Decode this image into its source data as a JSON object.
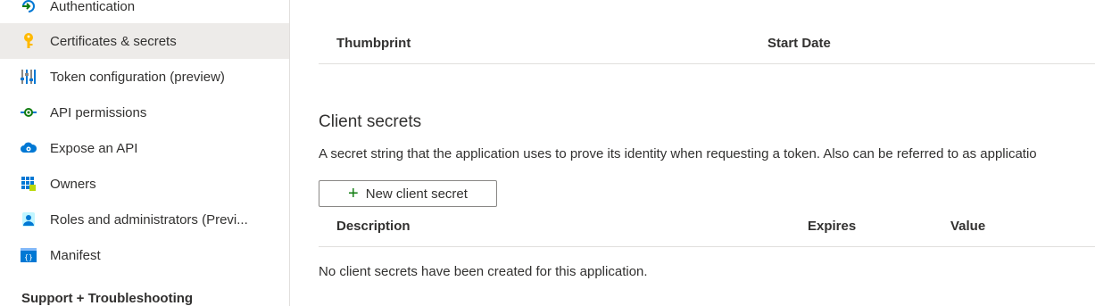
{
  "sidebar": {
    "items": [
      {
        "label": "Authentication",
        "icon": "authentication-icon"
      },
      {
        "label": "Certificates & secrets",
        "icon": "key-icon",
        "selected": true
      },
      {
        "label": "Token configuration (preview)",
        "icon": "token-configuration-icon"
      },
      {
        "label": "API permissions",
        "icon": "api-permissions-icon"
      },
      {
        "label": "Expose an API",
        "icon": "cloud-icon"
      },
      {
        "label": "Owners",
        "icon": "owners-icon"
      },
      {
        "label": "Roles and administrators (Previ...",
        "icon": "roles-icon"
      },
      {
        "label": "Manifest",
        "icon": "manifest-icon"
      }
    ],
    "section_header": "Support + Troubleshooting"
  },
  "certificates_table": {
    "columns": [
      "Thumbprint",
      "Start Date"
    ]
  },
  "client_secrets": {
    "heading": "Client secrets",
    "description": "A secret string that the application uses to prove its identity when requesting a token. Also can be referred to as applicatio",
    "new_button_label": "New client secret",
    "columns": [
      "Description",
      "Expires",
      "Value"
    ],
    "empty_message": "No client secrets have been created for this application."
  },
  "colors": {
    "accent_green": "#107c10",
    "selected_bg": "#edebe9",
    "key_yellow": "#ffb900",
    "azure_blue": "#0078d4"
  }
}
